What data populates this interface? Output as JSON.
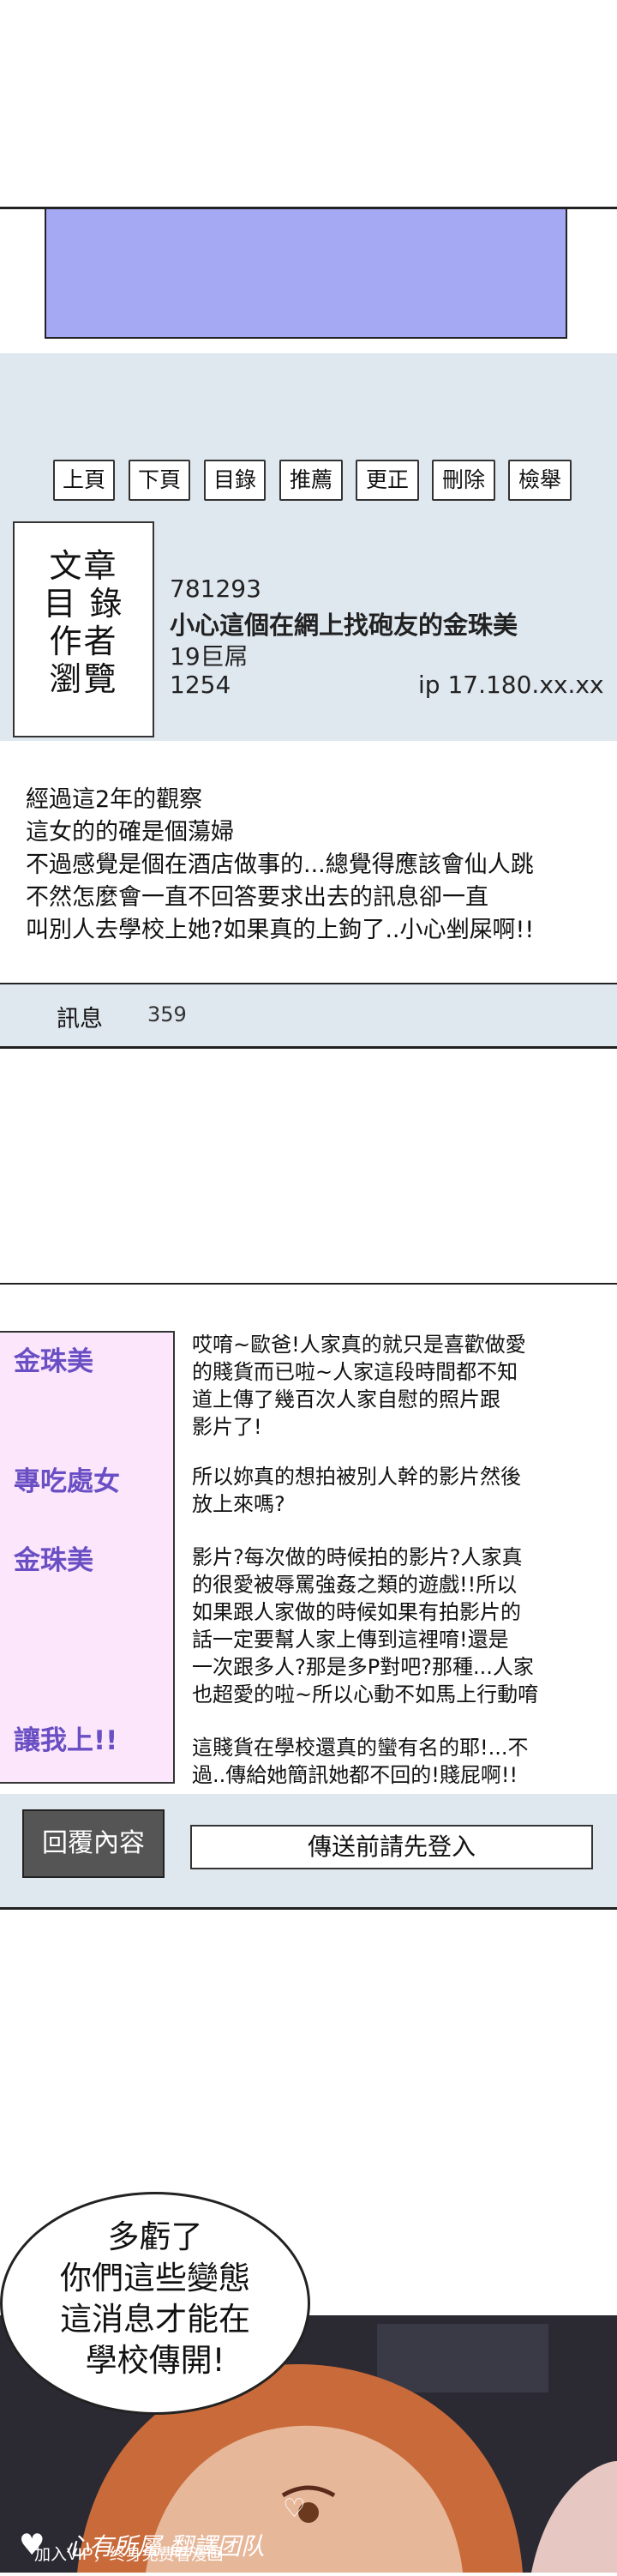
{
  "toolbar": {
    "buttons": [
      "上頁",
      "下頁",
      "目錄",
      "推薦",
      "更正",
      "刪除",
      "檢舉"
    ]
  },
  "post": {
    "labels": [
      "文章",
      "目 錄",
      "作者",
      "瀏覽"
    ],
    "article_id": "781293",
    "title": "小心這個在網上找砲友的金珠美",
    "author": "19巨屌",
    "views": "1254",
    "ip": "ip 17.180.xx.xx",
    "body": [
      "經過這2年的觀察",
      "這女的的確是個蕩婦",
      "不過感覺是個在酒店做事的...總覺得應該會仙人跳",
      "不然怎麼會一直不回答要求出去的訊息卻一直",
      "叫別人去學校上她?如果真的上鉤了..小心剉屎啊!!"
    ],
    "info_label": "訊息",
    "info_count": "359"
  },
  "replies": [
    {
      "name": "金珠美",
      "lines": [
        "哎唷~歐爸!人家真的就只是喜歡做愛",
        "的賤貨而已啦~人家這段時間都不知",
        "道上傳了幾百次人家自慰的照片跟",
        "影片了!"
      ]
    },
    {
      "name": "專吃處女",
      "lines": [
        "所以妳真的想拍被別人幹的影片然後",
        "放上來嗎?"
      ]
    },
    {
      "name": "金珠美",
      "lines": [
        "影片?每次做的時候拍的影片?人家真",
        "的很愛被辱罵強姦之類的遊戲!!所以",
        "如果跟人家做的時候如果有拍影片的",
        "話一定要幫人家上傳到這裡唷!還是",
        "一次跟多人?那是多P對吧?那種...人家",
        "也超愛的啦~所以心動不如馬上行動唷"
      ]
    },
    {
      "name": "讓我上!!",
      "lines": [
        "這賤貨在學校還真的蠻有名的耶!...不",
        "過..傳給她簡訊她都不回的!賤屁啊!!"
      ]
    }
  ],
  "reply_button": "回覆內容",
  "login_prompt": "傳送前請先登入",
  "speech_bubble": [
    "多虧了",
    "你們這些變態",
    "這消息才能在",
    "學校傳開!"
  ],
  "watermark": {
    "main": "心有所屬 翻譯团队",
    "sub": "加入VIP，终身免费看漫画"
  },
  "colors": {
    "panel_bg": "#dfe7ef",
    "banner_blue": "#a5a9f3",
    "name_purple": "#6a4fc4",
    "sidebar_pink": "#fbe6fb"
  }
}
